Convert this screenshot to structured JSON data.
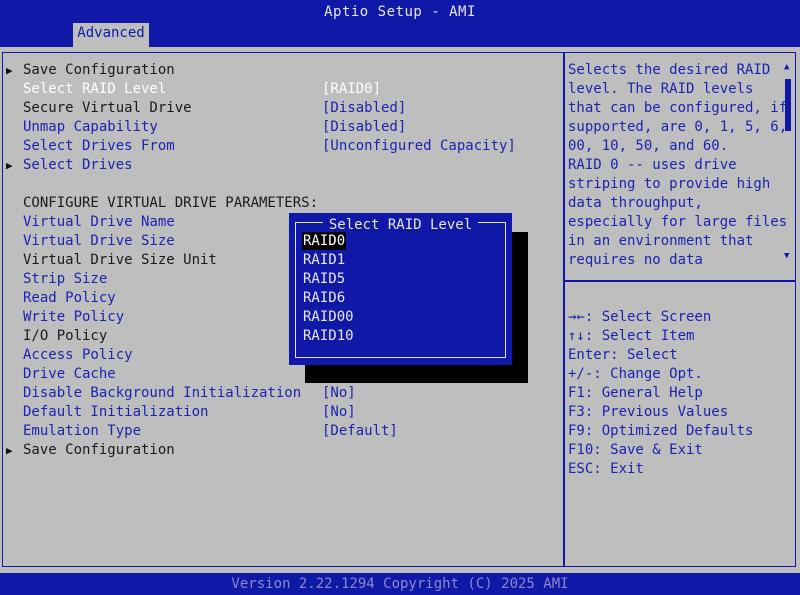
{
  "header": {
    "title": "Aptio Setup - AMI",
    "tab": "Advanced"
  },
  "menu": [
    {
      "arrow": true,
      "label": "Save Configuration",
      "value": "",
      "style": "black"
    },
    {
      "arrow": false,
      "label": "Select RAID Level",
      "value": "[RAID0]",
      "style": "selected"
    },
    {
      "arrow": false,
      "label": "Secure Virtual Drive",
      "value": "[Disabled]",
      "style": "black"
    },
    {
      "arrow": false,
      "label": "Unmap Capability",
      "value": "[Disabled]",
      "style": "blue"
    },
    {
      "arrow": false,
      "label": "Select Drives From",
      "value": "[Unconfigured Capacity]",
      "style": "blue"
    },
    {
      "arrow": true,
      "label": "Select Drives",
      "value": "",
      "style": "blue"
    },
    {
      "arrow": false,
      "label": "",
      "value": "",
      "style": "black"
    },
    {
      "arrow": false,
      "label": "CONFIGURE VIRTUAL DRIVE PARAMETERS:",
      "value": "",
      "style": "black"
    },
    {
      "arrow": false,
      "label": "Virtual Drive Name",
      "value": "",
      "style": "blue"
    },
    {
      "arrow": false,
      "label": "Virtual Drive Size",
      "value": "",
      "style": "blue"
    },
    {
      "arrow": false,
      "label": "Virtual Drive Size Unit",
      "value": "",
      "style": "black"
    },
    {
      "arrow": false,
      "label": "Strip Size",
      "value": "",
      "style": "blue"
    },
    {
      "arrow": false,
      "label": "Read Policy",
      "value": "",
      "style": "blue"
    },
    {
      "arrow": false,
      "label": "Write Policy",
      "value": "",
      "style": "blue"
    },
    {
      "arrow": false,
      "label": "I/O Policy",
      "value": "",
      "style": "black"
    },
    {
      "arrow": false,
      "label": "Access Policy",
      "value": "",
      "style": "blue"
    },
    {
      "arrow": false,
      "label": "Drive Cache",
      "value": "",
      "style": "blue"
    },
    {
      "arrow": false,
      "label": "Disable Background Initialization",
      "value": "[No]",
      "style": "blue"
    },
    {
      "arrow": false,
      "label": "Default Initialization",
      "value": "[No]",
      "style": "blue"
    },
    {
      "arrow": false,
      "label": "Emulation Type",
      "value": "[Default]",
      "style": "blue"
    },
    {
      "arrow": true,
      "label": "Save Configuration",
      "value": "",
      "style": "black"
    }
  ],
  "help": {
    "lines": [
      "Selects the desired RAID",
      "level. The RAID levels",
      "that can be configured, if",
      "supported, are 0, 1, 5, 6,",
      "00, 10, 50, and 60.",
      "RAID 0 -- uses drive",
      "striping to provide high",
      "data throughput,",
      "especially for large files",
      "in an environment that",
      "requires no data"
    ]
  },
  "keys": [
    "→←: Select Screen",
    "↑↓: Select Item",
    "Enter: Select",
    "+/-: Change Opt.",
    "F1: General Help",
    "F3: Previous Values",
    "F9: Optimized Defaults",
    "F10: Save & Exit",
    "ESC: Exit"
  ],
  "popup": {
    "title": "Select RAID Level",
    "options": [
      "RAID0",
      "RAID1",
      "RAID5",
      "RAID6",
      "RAID00",
      "RAID10"
    ],
    "selected": "RAID0"
  },
  "footer": {
    "version": "Version 2.22.1294 Copyright (C) 2025 AMI"
  },
  "icons": {
    "submenu": "triangle-right-icon",
    "scroll_up": "triangle-up-icon",
    "scroll_down": "triangle-down-icon"
  }
}
